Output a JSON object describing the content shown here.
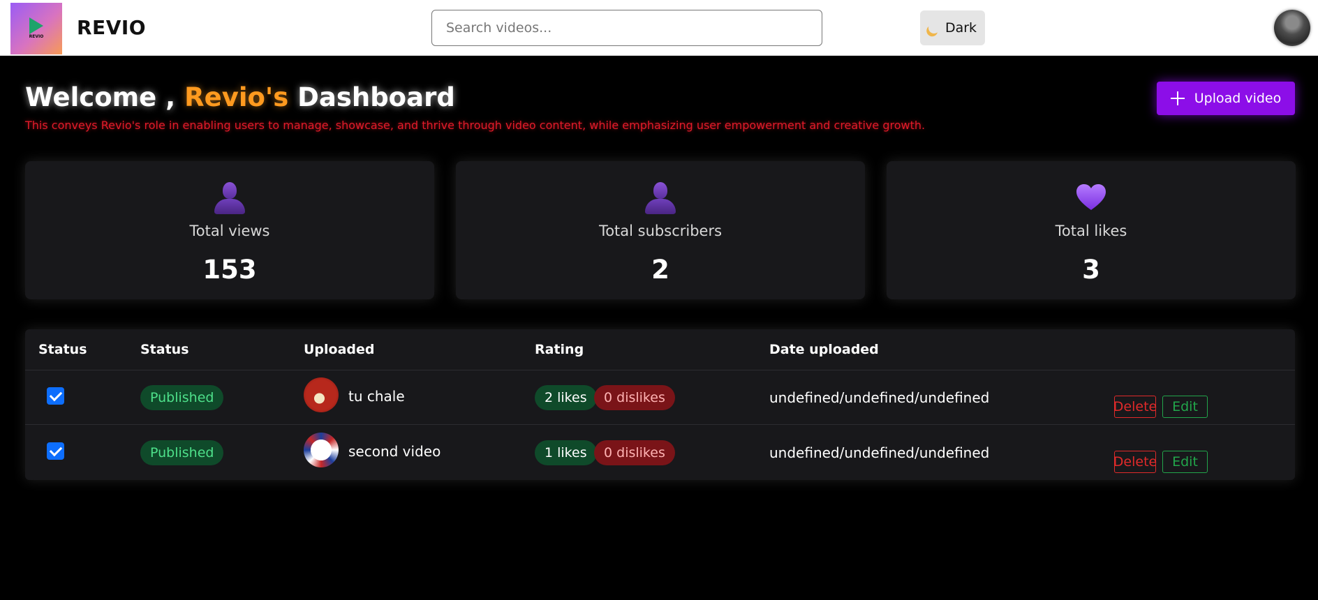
{
  "header": {
    "logo_text": "REVIO",
    "brand": "REVIO",
    "search_placeholder": "Search videos...",
    "theme_label": "Dark"
  },
  "title": {
    "prefix": "Welcome ,",
    "accent": "Revio's",
    "suffix": "Dashboard",
    "subtitle": "This conveys Revio's role in enabling users to manage, showcase, and thrive through video content, while emphasizing user empowerment and creative growth."
  },
  "upload_label": "Upload video",
  "stats": [
    {
      "label": "Total views",
      "value": "153",
      "icon": "user-icon"
    },
    {
      "label": "Total subscribers",
      "value": "2",
      "icon": "user-icon"
    },
    {
      "label": "Total likes",
      "value": "3",
      "icon": "heart-icon"
    }
  ],
  "table": {
    "headers": [
      "Status",
      "Status",
      "Uploaded",
      "Rating",
      "Date uploaded"
    ],
    "rows": [
      {
        "checked": true,
        "status": "Published",
        "title": "tu chale",
        "likes": "2 likes",
        "dislikes": "0 dislikes",
        "date": "undefined/undefined/undefined",
        "delete_label": "Delete",
        "edit_label": "Edit"
      },
      {
        "checked": true,
        "status": "Published",
        "title": "second video",
        "likes": "1 likes",
        "dislikes": "0 dislikes",
        "date": "undefined/undefined/undefined",
        "delete_label": "Delete",
        "edit_label": "Edit"
      }
    ]
  },
  "colors": {
    "accent_purple": "#8c0ee8",
    "title_accent": "#ff9a1f",
    "subtitle_red": "#e21b2a",
    "published_green": "#4ee08a"
  }
}
